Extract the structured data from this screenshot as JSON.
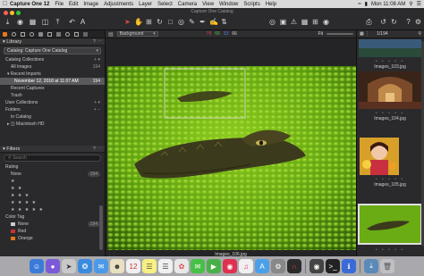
{
  "menubar": {
    "app_name": "Capture One 12",
    "items": [
      "File",
      "Edit",
      "Image",
      "Adjustments",
      "Layer",
      "Select",
      "Camera",
      "View",
      "Window",
      "Scripts",
      "Help"
    ],
    "clock": "Mon 11:08 AM"
  },
  "window": {
    "title": "Capture One Catalog"
  },
  "library": {
    "title": "Library",
    "catalog_select": "Catalog: Capture One Catalog",
    "catalog_collections_label": "Catalog Collections",
    "items": [
      {
        "label": "All Images",
        "count": "194"
      },
      {
        "label": "Recent Imports",
        "count": ""
      },
      {
        "label": "November 12, 2018 at 11:07 AM",
        "count": "194"
      },
      {
        "label": "Recent Captures",
        "count": ""
      },
      {
        "label": "Trash",
        "count": ""
      }
    ],
    "user_collections_label": "User Collections",
    "folders_label": "Folders",
    "folder_items": [
      "In Catalog",
      "Macintosh HD"
    ]
  },
  "filters": {
    "title": "Filters",
    "search_placeholder": "Search",
    "rating_label": "Rating",
    "rating_rows": [
      {
        "label": "None",
        "count": "194"
      },
      {
        "label": "★",
        "count": ""
      },
      {
        "label": "★ ★",
        "count": ""
      },
      {
        "label": "★ ★ ★",
        "count": ""
      },
      {
        "label": "★ ★ ★ ★",
        "count": ""
      },
      {
        "label": "★ ★ ★ ★ ★",
        "count": ""
      }
    ],
    "color_tag_label": "Color Tag",
    "color_rows": [
      {
        "label": "None",
        "count": "194",
        "color": "#cccccc"
      },
      {
        "label": "Red",
        "count": "",
        "color": "#d03030"
      },
      {
        "label": "Orange",
        "count": "",
        "color": "#e07820"
      }
    ]
  },
  "viewer": {
    "background_select": "Background",
    "readout": {
      "r": "79",
      "g": "66",
      "b": "33",
      "l": "66"
    },
    "fit_label": "Fit",
    "caption": "Images_106.jpg"
  },
  "browser": {
    "counter": "1/194",
    "thumbs": [
      {
        "label": "Images_103.jpg"
      },
      {
        "label": "Images_104.jpg"
      },
      {
        "label": "Images_105.jpg"
      },
      {
        "label": ""
      }
    ]
  },
  "colors": {
    "accent_red": "#e04848",
    "accent_green": "#48c048",
    "accent_blue": "#4880e0",
    "selection": "#5a5a5e"
  }
}
